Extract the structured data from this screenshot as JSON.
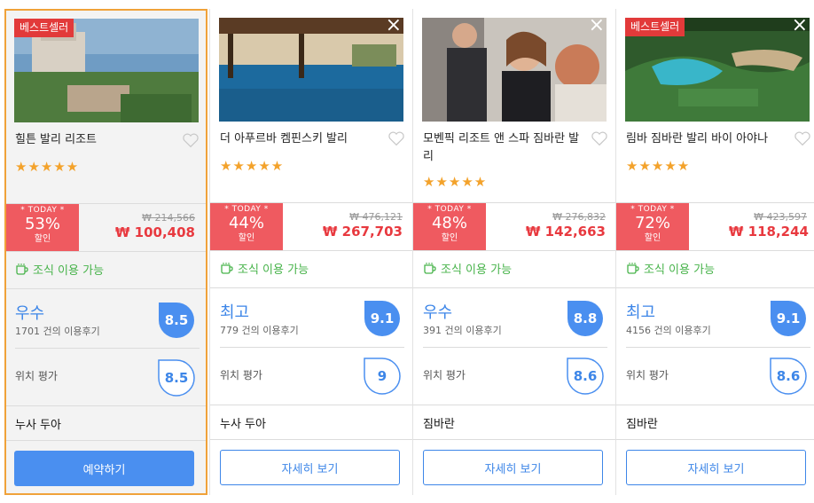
{
  "colors": {
    "accent": "#3d86e8",
    "sale": "#ef5a60",
    "price": "#e8393f",
    "star": "#f3a22b",
    "breakfast": "#47b34a",
    "selected_border": "#f0a23a"
  },
  "cards": [
    {
      "badge": "베스트셀러",
      "has_close": false,
      "name": "힐튼 발리 리조트",
      "stars": "★★★★★",
      "today": "* TODAY *",
      "discount_pct": "53%",
      "discount_label": "할인",
      "original_price": "₩ 214,566",
      "price": "₩ 100,408",
      "breakfast": "조식 이용 가능",
      "rating_word": "우수",
      "review_count": "1701 건의 이용후기",
      "score": "8.5",
      "location_label": "위치 평가",
      "location_score": "8.5",
      "area": "누사 두아",
      "button": "예약하기",
      "selected": true
    },
    {
      "badge": "",
      "has_close": true,
      "close_icon": "×",
      "name": "더 아푸르바 켐핀스키 발리",
      "stars": "★★★★★",
      "today": "* TODAY *",
      "discount_pct": "44%",
      "discount_label": "할인",
      "original_price": "₩ 476,121",
      "price": "₩ 267,703",
      "breakfast": "조식 이용 가능",
      "rating_word": "최고",
      "review_count": "779 건의 이용후기",
      "score": "9.1",
      "location_label": "위치 평가",
      "location_score": "9",
      "area": "누사 두아",
      "button": "자세히 보기",
      "selected": false
    },
    {
      "badge": "",
      "has_close": true,
      "close_icon": "×",
      "name": "모벤픽 리조트 앤 스파 짐바란 발리",
      "stars": "★★★★★",
      "today": "* TODAY *",
      "discount_pct": "48%",
      "discount_label": "할인",
      "original_price": "₩ 276,832",
      "price": "₩ 142,663",
      "breakfast": "조식 이용 가능",
      "rating_word": "우수",
      "review_count": "391 건의 이용후기",
      "score": "8.8",
      "location_label": "위치 평가",
      "location_score": "8.6",
      "area": "짐바란",
      "button": "자세히 보기",
      "selected": false
    },
    {
      "badge": "베스트셀러",
      "has_close": true,
      "close_icon": "×",
      "name": "림바 짐바란 발리 바이 아야나",
      "stars": "★★★★★",
      "today": "* TODAY *",
      "discount_pct": "72%",
      "discount_label": "할인",
      "original_price": "₩ 423,597",
      "price": "₩ 118,244",
      "breakfast": "조식 이용 가능",
      "rating_word": "최고",
      "review_count": "4156 건의 이용후기",
      "score": "9.1",
      "location_label": "위치 평가",
      "location_score": "8.6",
      "area": "짐바란",
      "button": "자세히 보기",
      "selected": false
    }
  ]
}
